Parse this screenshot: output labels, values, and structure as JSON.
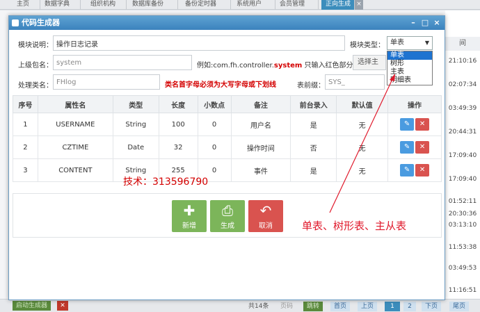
{
  "background": {
    "tabs": [
      "主页",
      "数据字典",
      "组织机构",
      "数据库备份",
      "备份定时器",
      "系统用户",
      "会员管理",
      "正向生成"
    ],
    "tab_close": "×",
    "right_column_header": "间",
    "times": [
      "21:10:16",
      "02:07:34",
      "03:49:39",
      "20:44:31",
      "17:09:40",
      "17:09:40",
      "01:52:11",
      "20:30:36",
      "03:13:10",
      "11:53:38",
      "03:49:53",
      "11:16:51"
    ],
    "bottom": {
      "start_button": "启动生成器",
      "delete_icon": "trash-icon",
      "total": "共14条",
      "page_label": "页码",
      "go": "跳转",
      "first": "首页",
      "prev": "上页",
      "page1": "1",
      "page2": "2",
      "next": "下页",
      "last": "尾页"
    }
  },
  "modal": {
    "title": "代码生成器",
    "controls": {
      "minimize": "–",
      "maximize": "□",
      "close": "×"
    },
    "module_desc_label": "模块说明：",
    "module_desc_value": "操作日志记录",
    "module_type_label": "模块类型：",
    "module_type_value": "单表",
    "module_type_options": [
      "单表",
      "树形",
      "主表",
      "明细表"
    ],
    "package_label": "上级包名：",
    "package_value": "system",
    "package_example_prefix": "例如:com.fh.controller.",
    "package_example_red": "system",
    "package_example_suffix": " 只输入红色部分",
    "select_main_button": "选择主表",
    "class_label": "处理类名：",
    "class_value": "FHlog",
    "class_warning": "类名首字母必须为大写字母或下划线",
    "prefix_label": "表前缀：",
    "prefix_value": "SYS_",
    "table": {
      "headers": [
        "序号",
        "属性名",
        "类型",
        "长度",
        "小数点",
        "备注",
        "前台录入",
        "默认值",
        "操作"
      ],
      "rows": [
        [
          "1",
          "USERNAME",
          "String",
          "100",
          "0",
          "用户名",
          "是",
          "无"
        ],
        [
          "2",
          "CZTIME",
          "Date",
          "32",
          "0",
          "操作时间",
          "否",
          "无"
        ],
        [
          "3",
          "CONTENT",
          "String",
          "255",
          "0",
          "事件",
          "是",
          "无"
        ]
      ]
    },
    "contact": "技术：313596790",
    "buttons": {
      "add": "新增",
      "generate": "生成",
      "cancel": "取消"
    }
  },
  "annotation": "单表、树形表、主从表"
}
